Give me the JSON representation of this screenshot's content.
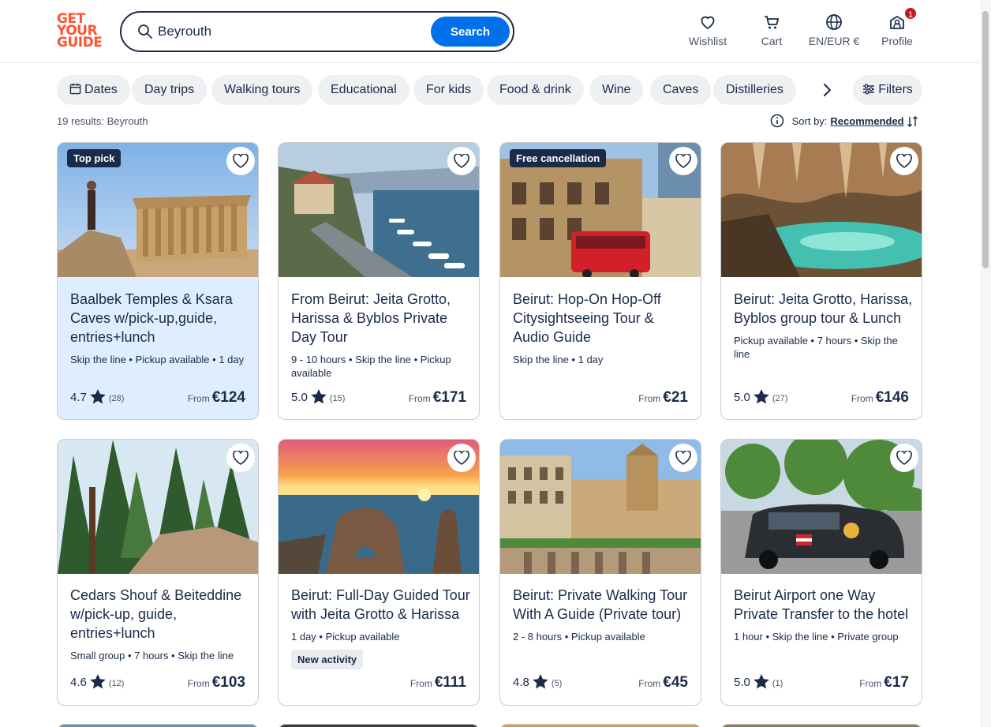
{
  "logo": {
    "line1": "GET",
    "line2": "YOUR",
    "line3": "GUIDE"
  },
  "search": {
    "value": "Beyrouth",
    "button": "Search"
  },
  "nav": {
    "wishlist": "Wishlist",
    "cart": "Cart",
    "language": "EN/EUR €",
    "profile": "Profile",
    "profile_badge": "1"
  },
  "chips": [
    "Dates",
    "Day trips",
    "Walking tours",
    "Educational",
    "For kids",
    "Food & drink",
    "Wine",
    "Caves",
    "Distilleries"
  ],
  "filters_label": "Filters",
  "results_text": "19 results: Beyrouth",
  "sort": {
    "label": "Sort by:",
    "value": "Recommended"
  },
  "cards": [
    {
      "tag": "Top pick",
      "title": "Baalbek Temples & Ksara Caves w/pick-up,guide, entries+lunch",
      "meta": "Skip the line • Pickup available • 1 day",
      "rating": "4.7",
      "count": "(28)",
      "from": "From",
      "price": "€124"
    },
    {
      "tag": "",
      "title": "From Beirut: Jeita Grotto, Harissa & Byblos Private Day Tour",
      "meta": "9 - 10 hours • Skip the line • Pickup available",
      "rating": "5.0",
      "count": "(15)",
      "from": "From",
      "price": "€171"
    },
    {
      "tag": "Free cancellation",
      "title": "Beirut: Hop-On Hop-Off Citysightseeing Tour & Audio Guide",
      "meta": "Skip the line • 1 day",
      "rating": "",
      "count": "",
      "from": "From",
      "price": "€21"
    },
    {
      "tag": "",
      "title": "Beirut: Jeita Grotto, Harissa, Byblos group tour & Lunch",
      "meta": "Pickup available • 7 hours • Skip the line",
      "rating": "5.0",
      "count": "(27)",
      "from": "From",
      "price": "€146"
    },
    {
      "tag": "",
      "title": "Cedars Shouf & Beiteddine w/pick-up, guide, entries+lunch",
      "meta": "Small group • 7 hours • Skip the line",
      "rating": "4.6",
      "count": "(12)",
      "from": "From",
      "price": "€103"
    },
    {
      "tag": "",
      "title": "Beirut: Full-Day Guided Tour with Jeita Grotto & Harissa",
      "meta": "1 day • Pickup available",
      "new": "New activity",
      "rating": "",
      "count": "",
      "from": "From",
      "price": "€111"
    },
    {
      "tag": "",
      "title": "Beirut: Private Walking Tour With A Guide (Private tour)",
      "meta": "2 - 8 hours • Pickup available",
      "rating": "4.8",
      "count": "(5)",
      "from": "From",
      "price": "€45"
    },
    {
      "tag": "",
      "title": "Beirut Airport one Way Private Transfer to the hotel",
      "meta": "1 hour • Skip the line • Private group",
      "rating": "5.0",
      "count": "(1)",
      "from": "From",
      "price": "€17"
    }
  ]
}
